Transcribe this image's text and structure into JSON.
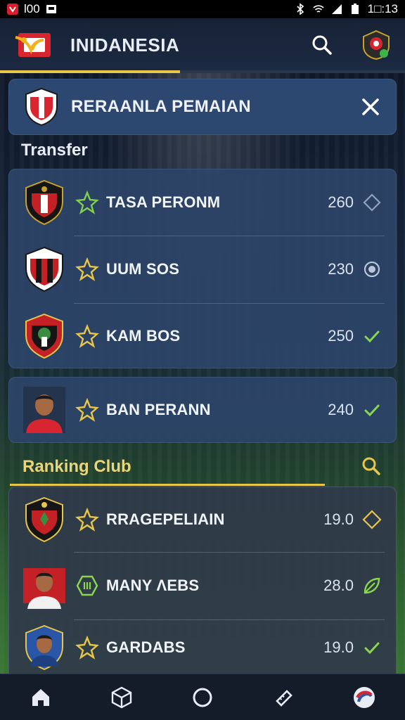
{
  "status_bar": {
    "left_text": "Ɩ00",
    "time": "1□:13"
  },
  "app_bar": {
    "title": "INIDANESIA"
  },
  "modal": {
    "title": "RERAANLA PEMAIAN"
  },
  "transfer": {
    "label": "Transfer",
    "items": [
      {
        "name": "TASA PERONM",
        "value": "260",
        "status": "diamond-outline"
      },
      {
        "name": "UUM SOS",
        "value": "230",
        "status": "radio-target"
      },
      {
        "name": "KAM BOS",
        "value": "250",
        "status": "check"
      }
    ],
    "single": {
      "name": "BAN PERANN",
      "value": "240",
      "status": "check"
    }
  },
  "ranking": {
    "label": "Ranking Club",
    "items": [
      {
        "name": "RRAGEPELIAIN",
        "value": "19.0",
        "status": "diamond-outline"
      },
      {
        "name": "MANY ΛEBS",
        "value": "28.0",
        "status": "leaf"
      },
      {
        "name": "GARDABS",
        "value": "19.0",
        "status": "check"
      }
    ]
  },
  "colors": {
    "accent": "#e7c64a",
    "check": "#8bd64f",
    "panel": "#2c4468"
  },
  "nav": [
    "home-icon",
    "box-icon",
    "circle-icon",
    "ticket-icon",
    "profile-badge-icon"
  ]
}
